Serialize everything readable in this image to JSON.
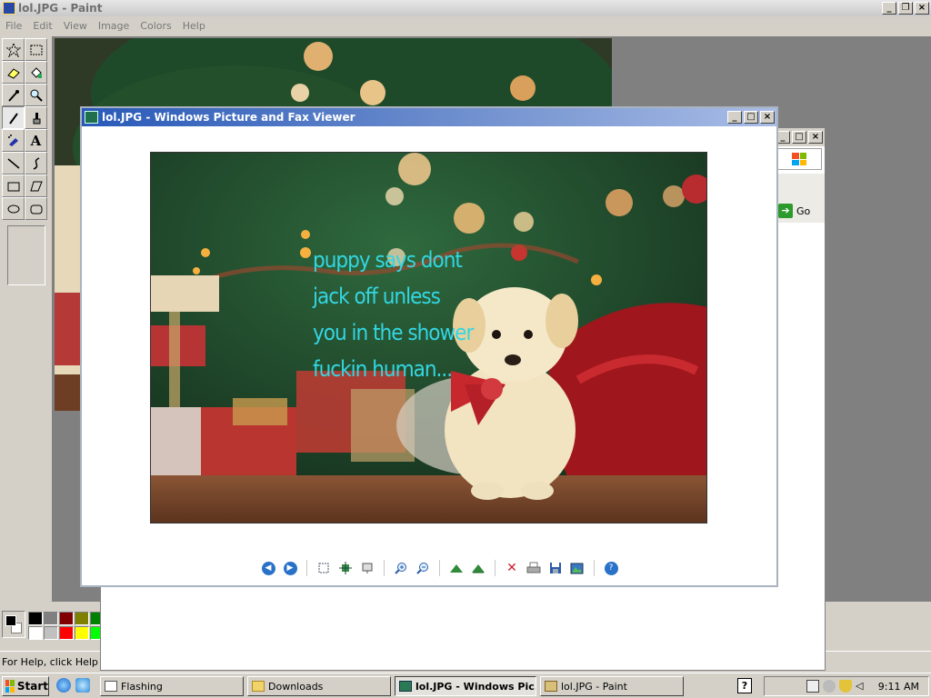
{
  "paint": {
    "title": "lol.JPG - Paint",
    "menu": [
      "File",
      "Edit",
      "View",
      "Image",
      "Colors",
      "Help"
    ],
    "status_text": "For Help, click Help Topics on the Help Menu.",
    "palette": [
      "#000000",
      "#808080",
      "#800000",
      "#808000",
      "#008000",
      "#ffffff",
      "#c0c0c0",
      "#ff0000",
      "#ffff00",
      "#00ff00"
    ]
  },
  "viewer": {
    "title": "lol.JPG - Windows Picture and Fax Viewer",
    "caption_lines": [
      "puppy says dont",
      "jack off unless",
      "you in the shower",
      "fuckin human..."
    ]
  },
  "background_window": {
    "go_label": "Go"
  },
  "taskbar": {
    "start_label": "Start",
    "tasks": [
      "Flashing",
      "Downloads",
      "lol.JPG - Windows Pic...",
      "lol.JPG - Paint"
    ],
    "clock": "9:11 AM"
  }
}
